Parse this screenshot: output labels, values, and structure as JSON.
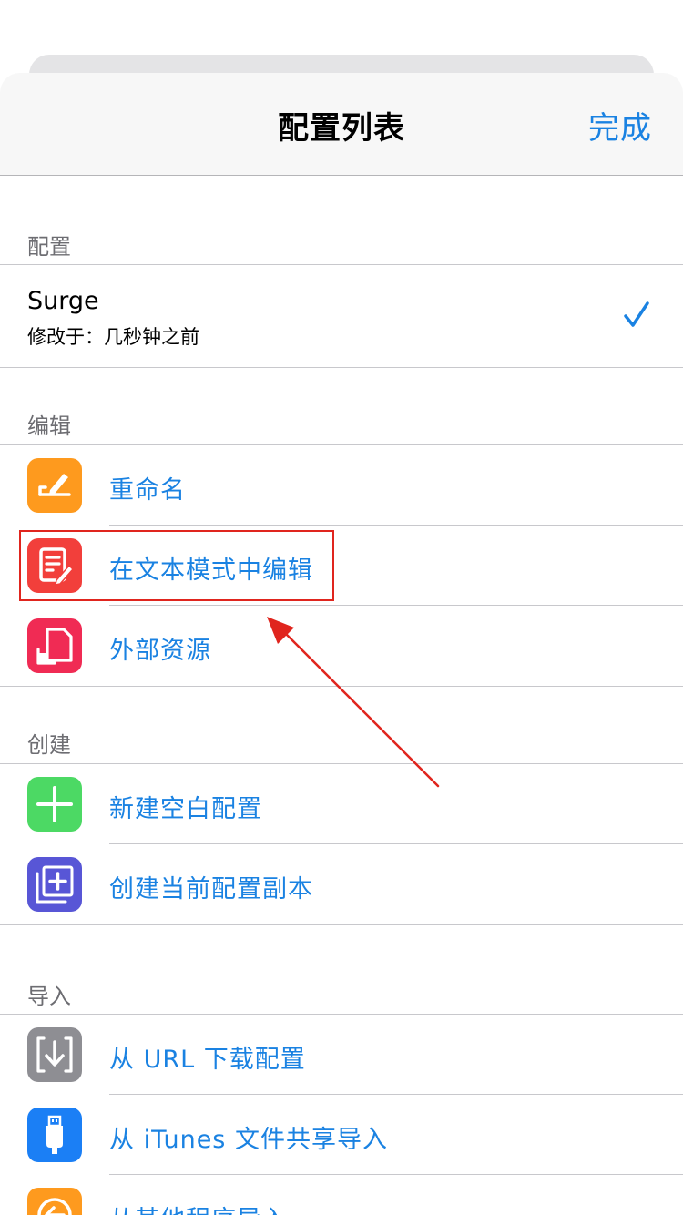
{
  "nav": {
    "title": "配置列表",
    "done_label": "完成"
  },
  "sections": {
    "config": {
      "header": "配置",
      "profile": {
        "name": "Surge",
        "modified": "修改于：几秒钟之前",
        "selected": true
      }
    },
    "edit": {
      "header": "编辑",
      "items": [
        {
          "label": "重命名",
          "icon": "rename-pencil-icon",
          "color": "#fe9a1e"
        },
        {
          "label": "在文本模式中编辑",
          "icon": "text-edit-icon",
          "color": "#f23f3b"
        },
        {
          "label": "外部资源",
          "icon": "external-resource-icon",
          "color": "#f02b54"
        }
      ]
    },
    "create": {
      "header": "创建",
      "items": [
        {
          "label": "新建空白配置",
          "icon": "plus-icon",
          "color": "#4cd964"
        },
        {
          "label": "创建当前配置副本",
          "icon": "duplicate-icon",
          "color": "#5856d6"
        }
      ]
    },
    "import": {
      "header": "导入",
      "items": [
        {
          "label": "从 URL 下载配置",
          "icon": "download-icon",
          "color": "#8e8e93"
        },
        {
          "label": "从 iTunes 文件共享导入",
          "icon": "usb-icon",
          "color": "#1b7ff5"
        },
        {
          "label": "从其他程序导入",
          "icon": "import-arrow-icon",
          "color": "#fe9a1e"
        }
      ]
    }
  },
  "colors": {
    "accent": "#1a82e2",
    "annotation": "#e0251e"
  }
}
